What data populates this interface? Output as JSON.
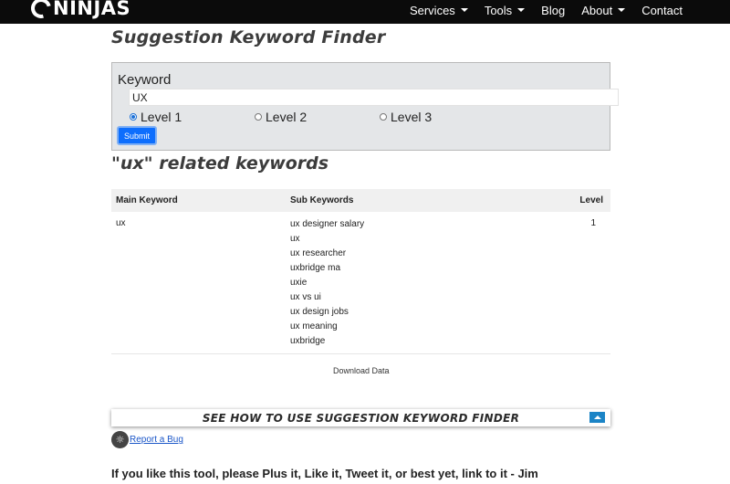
{
  "nav": {
    "logo_text": "NINJAS",
    "items": [
      {
        "label": "Services",
        "dropdown": true
      },
      {
        "label": "Tools",
        "dropdown": true
      },
      {
        "label": "Blog",
        "dropdown": false
      },
      {
        "label": "About",
        "dropdown": true
      },
      {
        "label": "Contact",
        "dropdown": false
      }
    ]
  },
  "page": {
    "title": "Suggestion Keyword Finder"
  },
  "form": {
    "label": "Keyword",
    "input_value": "UX",
    "levels": [
      {
        "label": "Level 1",
        "checked": true
      },
      {
        "label": "Level 2",
        "checked": false
      },
      {
        "label": "Level 3",
        "checked": false
      }
    ],
    "submit_label": "Submit"
  },
  "results": {
    "title": "\"ux\" related keywords",
    "columns": [
      "Main Keyword",
      "Sub Keywords",
      "Level"
    ],
    "rows": [
      {
        "main": "ux",
        "subs": [
          "ux designer salary",
          "ux",
          "ux researcher",
          "uxbridge ma",
          "uxie",
          "ux vs ui",
          "ux design jobs",
          "ux meaning",
          "uxbridge"
        ],
        "level": "1"
      }
    ],
    "download_label": "Download Data"
  },
  "howto": {
    "label": "SEE HOW TO USE SUGGESTION KEYWORD FINDER"
  },
  "report": {
    "label": "Report a Bug"
  },
  "footer": {
    "text": "If you like this tool, please Plus it, Like it, Tweet it, or best yet, link to it - Jim"
  },
  "colors": {
    "navbar": "#0b0b0b",
    "accent": "#0d6efd",
    "form_bg": "#e4e6e8"
  }
}
